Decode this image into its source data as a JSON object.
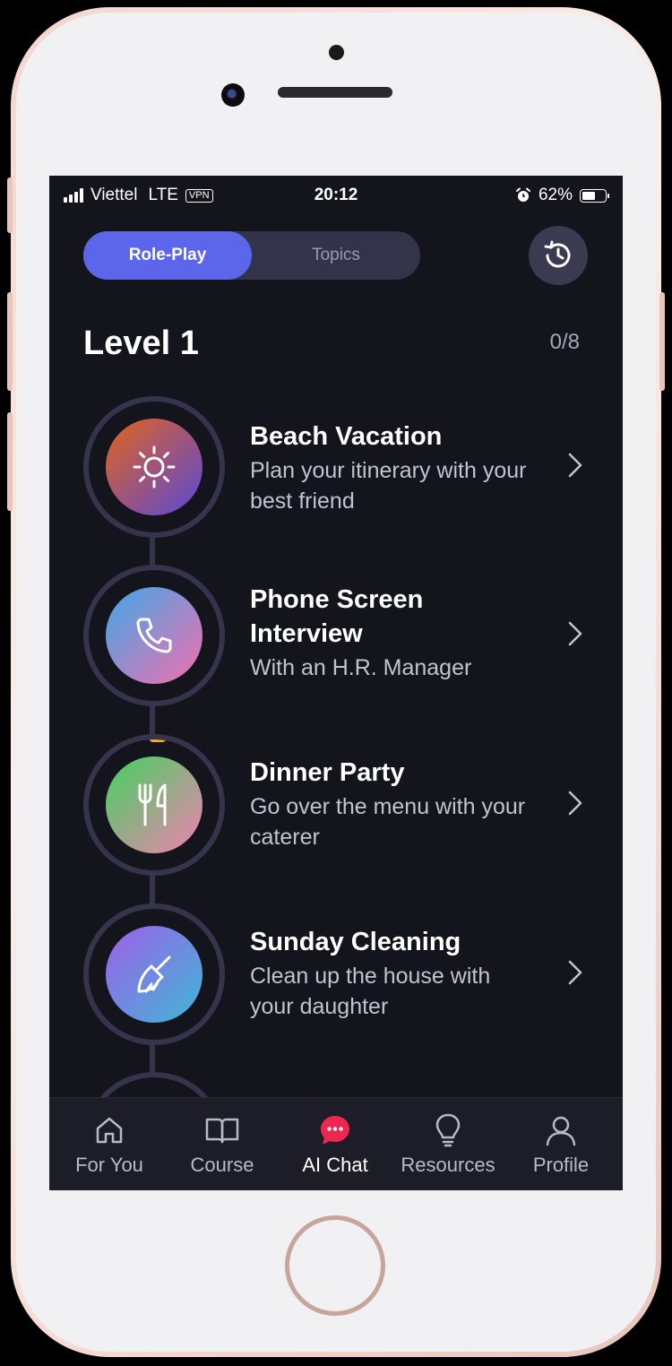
{
  "status_bar": {
    "carrier": "Viettel",
    "network": "LTE",
    "vpn": "VPN",
    "time": "20:12",
    "battery": "62%",
    "battery_level": 0.62
  },
  "segmented_control": {
    "active": "Role-Play",
    "inactive": "Topics"
  },
  "history_button": {
    "icon": "history-icon"
  },
  "level": {
    "title": "Level 1",
    "progress": "0/8"
  },
  "lessons": [
    {
      "title": "Beach Vacation",
      "subtitle": "Plan your itinerary with your best friend",
      "icon": "sun-icon",
      "colors": [
        "#e2631d",
        "#5a48d8"
      ]
    },
    {
      "title": "Phone Screen Interview",
      "subtitle": "With an H.R. Manager",
      "icon": "phone-icon",
      "colors": [
        "#3da8e8",
        "#f46fae"
      ]
    },
    {
      "title": "Dinner Party",
      "subtitle": "Go over the menu with your caterer",
      "icon": "fork-knife-icon",
      "colors": [
        "#3fd45e",
        "#f27fb2"
      ]
    },
    {
      "title": "Sunday Cleaning",
      "subtitle": "Clean up the house with your daughter",
      "icon": "broom-icon",
      "colors": [
        "#9f5fe8",
        "#3fb7d6"
      ]
    }
  ],
  "tabs": [
    {
      "label": "For You",
      "icon": "home-icon"
    },
    {
      "label": "Course",
      "icon": "book-icon"
    },
    {
      "label": "AI Chat",
      "icon": "chat-icon",
      "active": true,
      "color": "#f0264f"
    },
    {
      "label": "Resources",
      "icon": "lightbulb-icon"
    },
    {
      "label": "Profile",
      "icon": "user-icon"
    }
  ]
}
